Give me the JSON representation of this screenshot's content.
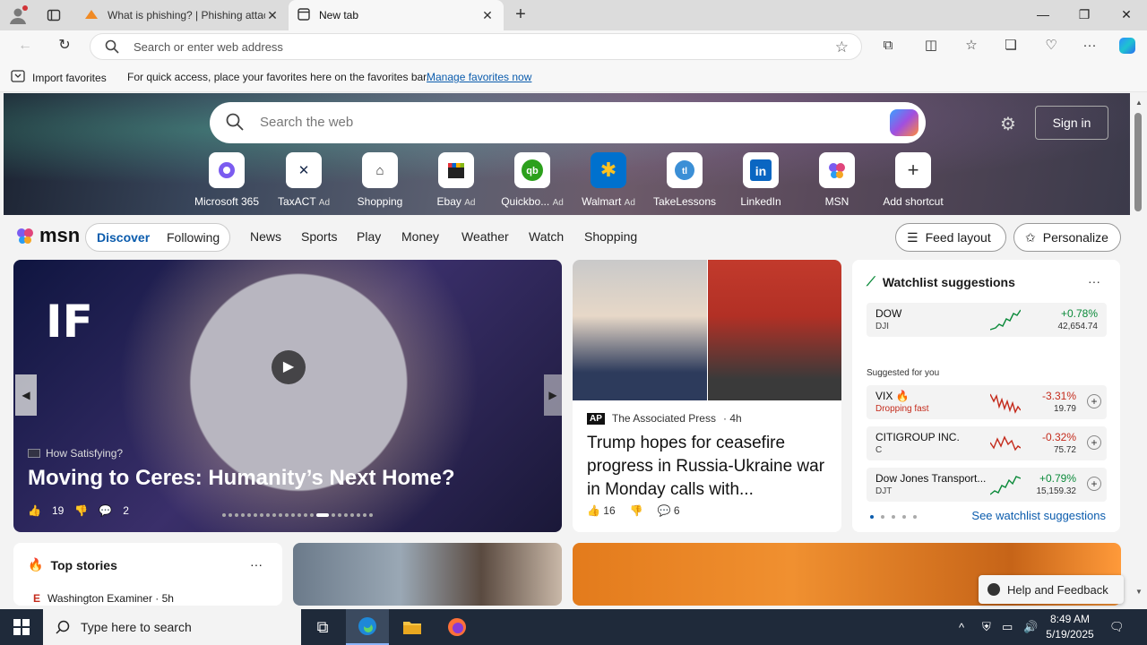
{
  "browser": {
    "tabs": [
      {
        "title": "What is phishing? | Phishing attacks",
        "icon": "anyrun-icon",
        "active": false
      },
      {
        "title": "New tab",
        "icon": "newtab-icon",
        "active": true
      }
    ],
    "address_placeholder": "Search or enter web address",
    "favorites_bar": {
      "import_label": "Import favorites",
      "hint": "For quick access, place your favorites here on the favorites bar.",
      "manage_link": "Manage favorites now"
    }
  },
  "newtab": {
    "search_placeholder": "Search the web",
    "signin_label": "Sign in",
    "tiles": [
      {
        "label": "Microsoft 365",
        "ad": ""
      },
      {
        "label": "TaxACT",
        "ad": "Ad"
      },
      {
        "label": "Shopping",
        "ad": ""
      },
      {
        "label": "Ebay",
        "ad": "Ad"
      },
      {
        "label": "Quickbo...",
        "ad": "Ad"
      },
      {
        "label": "Walmart",
        "ad": "Ad"
      },
      {
        "label": "TakeLessons",
        "ad": ""
      },
      {
        "label": "LinkedIn",
        "ad": ""
      },
      {
        "label": "MSN",
        "ad": ""
      },
      {
        "label": "Add shortcut",
        "ad": ""
      }
    ]
  },
  "msn": {
    "logo": "msn",
    "pills": {
      "discover": "Discover",
      "following": "Following"
    },
    "nav": [
      "News",
      "Sports",
      "Play",
      "Money",
      "Weather",
      "Watch",
      "Shopping"
    ],
    "feed_layout": "Feed layout",
    "personalize": "Personalize"
  },
  "carousel": {
    "brand": "IF",
    "source": "How Satisfying?",
    "headline": "Moving to Ceres: Humanity’s Next Home?",
    "likes": "19",
    "comments": "2",
    "slide_count": 23,
    "active_slide": 15
  },
  "news": {
    "source": "The Associated Press",
    "age": "4h",
    "title": "Trump hopes for ceasefire progress in Russia-Ukraine war in Monday calls with...",
    "likes": "16",
    "comments": "6"
  },
  "watchlist": {
    "title": "Watchlist suggestions",
    "main": {
      "name": "DOW",
      "ticker": "DJI",
      "change": "+0.78%",
      "value": "42,654.74"
    },
    "suggested_label": "Suggested for you",
    "suggested": [
      {
        "name": "VIX",
        "ticker": "Dropping fast",
        "change": "-3.31%",
        "value": "19.79",
        "dir": "down"
      },
      {
        "name": "CITIGROUP INC.",
        "ticker": "C",
        "change": "-0.32%",
        "value": "75.72",
        "dir": "down"
      },
      {
        "name": "Dow Jones Transport...",
        "ticker": "DJT",
        "change": "+0.79%",
        "value": "15,159.32",
        "dir": "up"
      }
    ],
    "see_all": "See watchlist suggestions"
  },
  "top_stories": {
    "title": "Top stories",
    "first_source": "Washington Examiner · 5h"
  },
  "feedback": "Help and Feedback",
  "taskbar": {
    "search_placeholder": "Type here to search",
    "time": "8:49 AM",
    "date": "5/19/2025"
  },
  "colors": {
    "accent": "#0b5cad",
    "up": "#0b8a3a",
    "down": "#c42b1c",
    "taskbar": "#1f2a3a"
  }
}
